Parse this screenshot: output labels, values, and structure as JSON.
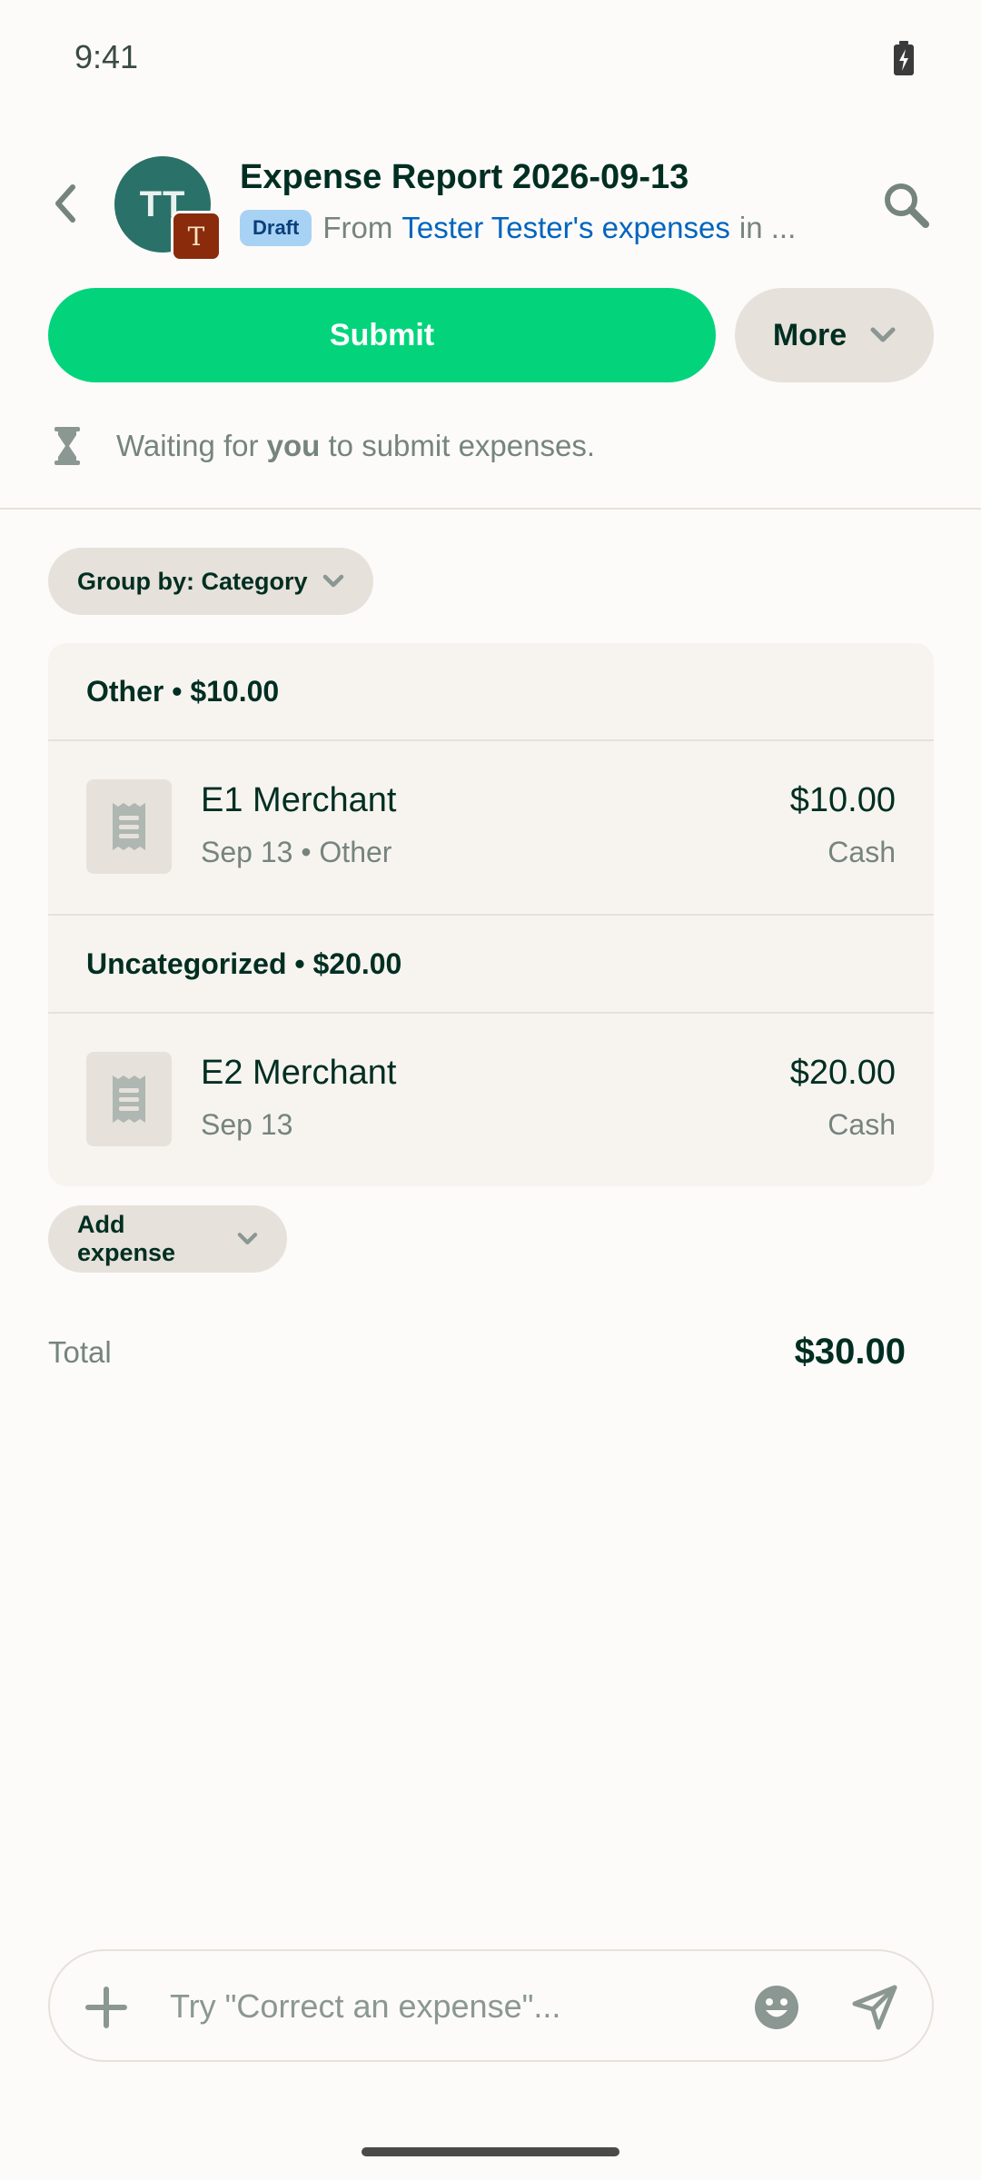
{
  "status_bar": {
    "time": "9:41"
  },
  "header": {
    "avatar_initials": "TT",
    "workspace_badge": "T",
    "title": "Expense Report 2026-09-13",
    "status_badge": "Draft",
    "from_label": "From",
    "from_link": "Tester Tester's expenses",
    "in_label": "in ..."
  },
  "actions": {
    "submit_label": "Submit",
    "more_label": "More"
  },
  "waiting": {
    "prefix": "Waiting for ",
    "actor": "you",
    "suffix": " to submit expenses."
  },
  "group_by": {
    "label": "Group by: Category"
  },
  "sections": [
    {
      "header": "Other • $10.00",
      "expenses": [
        {
          "merchant": "E1 Merchant",
          "meta": "Sep 13 • Other",
          "amount": "$10.00",
          "payment": "Cash"
        }
      ]
    },
    {
      "header": "Uncategorized • $20.00",
      "expenses": [
        {
          "merchant": "E2 Merchant",
          "meta": "Sep 13",
          "amount": "$20.00",
          "payment": "Cash"
        }
      ]
    }
  ],
  "add_expense": {
    "label": "Add expense"
  },
  "total": {
    "label": "Total",
    "value": "$30.00"
  },
  "composer": {
    "placeholder": "Try \"Correct an expense\"..."
  },
  "icons": {
    "back": "chevron-left-icon",
    "search": "search-icon",
    "chevron": "chevron-down-icon",
    "hourglass": "hourglass-icon",
    "receipt": "receipt-icon",
    "plus": "plus-icon",
    "emoji": "emoji-icon",
    "send": "send-icon",
    "battery": "battery-charging-icon"
  },
  "colors": {
    "accent_green": "#03D47C",
    "link_blue": "#0164BF",
    "badge_blue": "#A8D2F4",
    "avatar_teal": "#2A7169",
    "workspace_brown": "#8A2B0C"
  }
}
